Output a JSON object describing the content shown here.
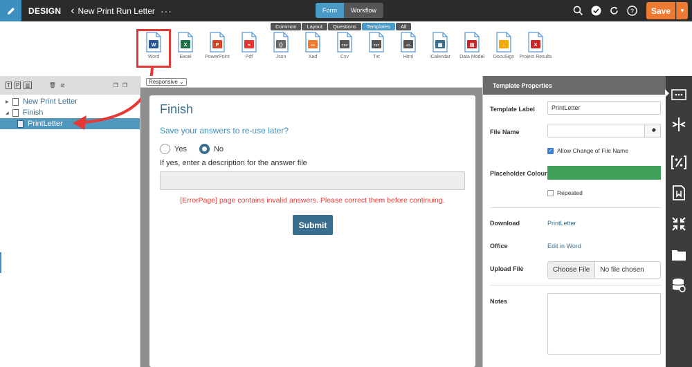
{
  "topbar": {
    "brand": "DESIGN",
    "back_glyph": "‹",
    "document_title": "New Print Run Letter",
    "more_glyph": "···",
    "modes": [
      "Form",
      "Workflow"
    ],
    "save_label": "Save",
    "icons": [
      "search-icon",
      "check-circle-icon",
      "refresh-icon",
      "help-icon"
    ]
  },
  "filters": [
    {
      "label": "Common",
      "active": false
    },
    {
      "label": "Layout",
      "active": false
    },
    {
      "label": "Questions",
      "active": false
    },
    {
      "label": "Templates",
      "active": true
    },
    {
      "label": "All",
      "active": false
    }
  ],
  "tools": [
    {
      "label": "Word",
      "color": "#2b579a",
      "mark": "W"
    },
    {
      "label": "Excel",
      "color": "#217346",
      "mark": "X"
    },
    {
      "label": "PowerPoint",
      "color": "#d24726",
      "mark": "P"
    },
    {
      "label": "Pdf",
      "color": "#e53935",
      "mark": "⌁"
    },
    {
      "label": "Json",
      "color": "#666666",
      "mark": "{}"
    },
    {
      "label": "Xad",
      "color": "#ec7a30",
      "mark": "</>"
    },
    {
      "label": "Csv",
      "color": "#555555",
      "mark": "CSV"
    },
    {
      "label": "Txt",
      "color": "#555555",
      "mark": "TXT"
    },
    {
      "label": "Html",
      "color": "#555555",
      "mark": "</>"
    },
    {
      "label": "iCalendar",
      "color": "#3a6e8f",
      "mark": "▦"
    },
    {
      "label": "Data Model",
      "color": "#c62828",
      "mark": "▤"
    },
    {
      "label": "DocuSign",
      "color": "#f2a900",
      "mark": "↓"
    },
    {
      "label": "Project Results",
      "color": "#c62828",
      "mark": "✕"
    }
  ],
  "tree": [
    {
      "label": "New Print Letter",
      "expanded": false
    },
    {
      "label": "Finish",
      "expanded": true
    },
    {
      "label": "PrintLetter",
      "selected": true
    }
  ],
  "center": {
    "view_select": "Responsive",
    "page_title": "Finish",
    "question": "Save your answers to re-use later?",
    "yes_label": "Yes",
    "no_label": "No",
    "description_label": "If yes, enter a description for the answer file",
    "error_text": "[ErrorPage] page contains invalid answers. Please correct them before continuing.",
    "submit_label": "Submit"
  },
  "properties": {
    "header": "Template Properties",
    "template_label_label": "Template Label",
    "template_label_value": "PrintLetter",
    "file_name_label": "File Name",
    "file_name_value": "",
    "allow_change_label": "Allow Change of File Name",
    "allow_change_checked": true,
    "placeholder_colour_label": "Placeholder Colour",
    "placeholder_colour": "#3fa05a",
    "repeated_label": "Repeated",
    "repeated_checked": false,
    "download_label": "Download",
    "download_link": "PrintLetter",
    "office_label": "Office",
    "office_link": "Edit in Word",
    "upload_label": "Upload File",
    "choose_file_label": "Choose File",
    "no_file_label": "No file chosen",
    "notes_label": "Notes"
  },
  "rail_icons": [
    "ellipsis-box-icon",
    "split-icon",
    "percent-doc-icon",
    "bookmark-doc-icon",
    "compress-icon",
    "folder-icon",
    "database-settings-icon"
  ]
}
